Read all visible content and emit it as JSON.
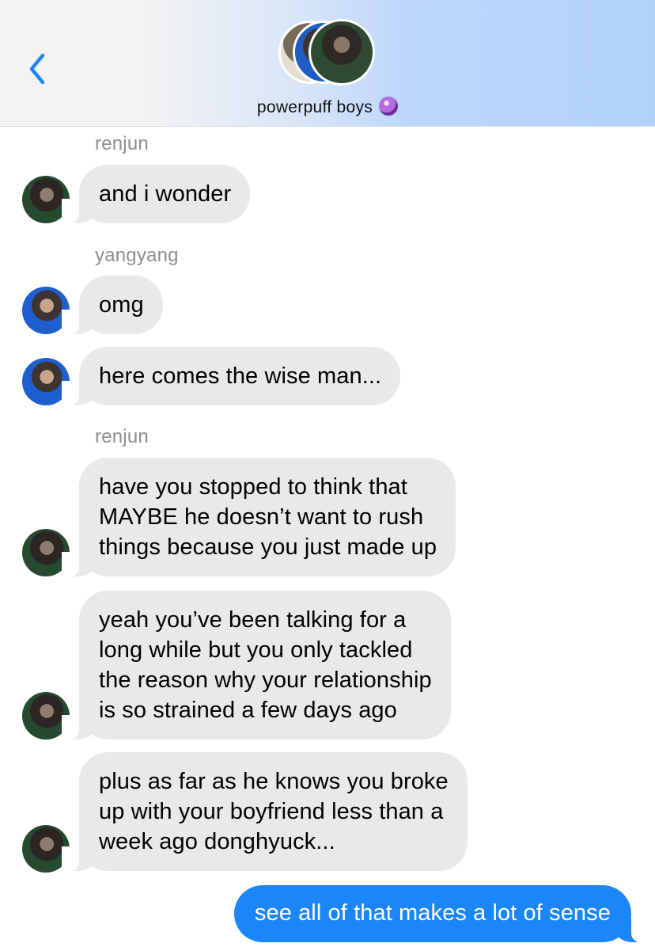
{
  "header": {
    "back_icon": "chevron-left-icon",
    "group_name": "powerpuff boys",
    "group_emoji": "crystal-ball-icon",
    "accent": "#1b86fa"
  },
  "messages": [
    {
      "sender": "renjun",
      "text": "and i wonder"
    },
    {
      "sender": "yangyang",
      "text": "omg"
    },
    {
      "text": "here comes the wise man..."
    },
    {
      "sender": "renjun",
      "text": "have you stopped to think that\nMAYBE he doesn’t want to rush\nthings because you just made up"
    },
    {
      "text": "yeah you’ve been talking for a\nlong while but you only tackled\nthe reason why your relationship\nis so strained a few days ago"
    },
    {
      "text": "plus as far as he knows you broke\nup with your boyfriend less than a\nweek ago donghyuck..."
    }
  ],
  "sent_message": {
    "text": "see all of that makes a lot of sense"
  },
  "colors": {
    "incoming_bubble": "#e9e9eb",
    "outgoing_bubble": "#1b86fa",
    "sender_label": "#8e8e93"
  }
}
